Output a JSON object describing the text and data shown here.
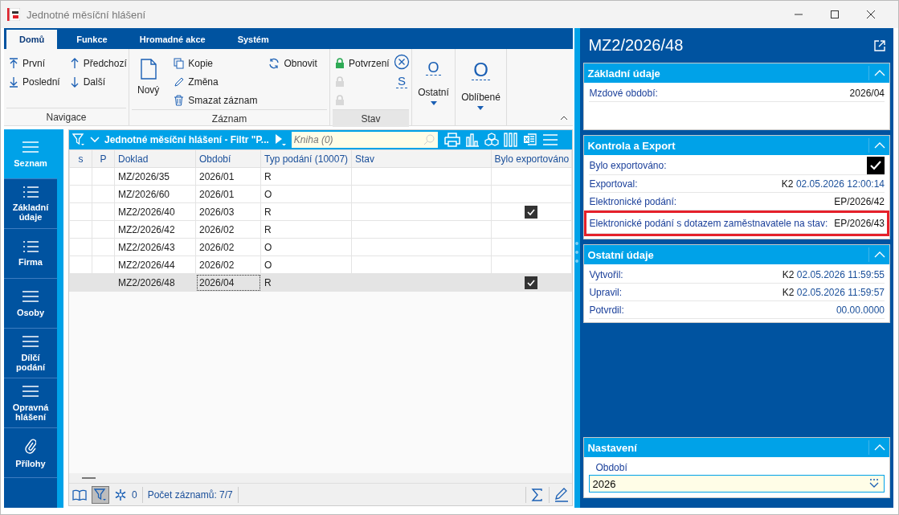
{
  "window": {
    "title": "Jednotné měsíční hlášení"
  },
  "ribbon": {
    "tabs": [
      {
        "label": "Domů",
        "selected": true
      },
      {
        "label": "Funkce",
        "selected": false
      },
      {
        "label": "Hromadné akce",
        "selected": false
      },
      {
        "label": "Systém",
        "selected": false
      }
    ],
    "navigace": {
      "title": "Navigace",
      "buttons": [
        {
          "label": "První",
          "kind": "first"
        },
        {
          "label": "Předchozí",
          "kind": "up"
        },
        {
          "label": "Poslední",
          "kind": "last"
        },
        {
          "label": "Další",
          "kind": "down"
        }
      ]
    },
    "zaznam": {
      "title": "Záznam",
      "new": "Nový",
      "buttons": [
        {
          "label": "Kopie",
          "kind": "copy"
        },
        {
          "label": "Změna",
          "kind": "edit"
        },
        {
          "label": "Smazat záznam",
          "kind": "delete"
        }
      ],
      "refresh": "Obnovit"
    },
    "stav": {
      "title": "Stav",
      "locks": [
        {
          "label": "Potvrzení",
          "disabled": false
        },
        {
          "disabled": true
        },
        {
          "disabled": true
        }
      ],
      "shortcut": "S"
    },
    "menus": [
      {
        "label": "Ostatní",
        "glyph": "O"
      },
      {
        "label": "Oblíbené",
        "glyph": "O"
      }
    ]
  },
  "sidebar": {
    "items": [
      {
        "label": "Seznam",
        "kind": "menu",
        "selected": true
      },
      {
        "label": "Základní údaje",
        "kind": "list",
        "selected": false
      },
      {
        "label": "Firma",
        "kind": "list",
        "selected": false
      },
      {
        "label": "Osoby",
        "kind": "menu",
        "selected": false
      },
      {
        "label": "Dílčí podání",
        "kind": "menu",
        "selected": false
      },
      {
        "label": "Opravná hlášení",
        "kind": "menu",
        "selected": false
      },
      {
        "label": "Přílohy",
        "kind": "attachment",
        "selected": false
      }
    ]
  },
  "grid": {
    "title": "Jednotné měsíční hlášení - Filtr \"P...",
    "search": {
      "placeholder": "Kniha (0)"
    },
    "columns": [
      "s",
      "P",
      "Doklad",
      "Období",
      "Typ podání (10007)",
      "Stav",
      "Bylo exportováno"
    ],
    "rows": [
      {
        "doklad": "MZ/2026/35",
        "obdobi": "2026/01",
        "typ": "R",
        "exported": false,
        "selected": false
      },
      {
        "doklad": "MZ/2026/60",
        "obdobi": "2026/01",
        "typ": "O",
        "exported": false,
        "selected": false
      },
      {
        "doklad": "MZ2/2026/40",
        "obdobi": "2026/03",
        "typ": "R",
        "exported": true,
        "selected": false
      },
      {
        "doklad": "MZ2/2026/42",
        "obdobi": "2026/02",
        "typ": "R",
        "exported": false,
        "selected": false
      },
      {
        "doklad": "MZ2/2026/43",
        "obdobi": "2026/02",
        "typ": "O",
        "exported": false,
        "selected": false
      },
      {
        "doklad": "MZ2/2026/44",
        "obdobi": "2026/02",
        "typ": "O",
        "exported": false,
        "selected": false
      },
      {
        "doklad": "MZ2/2026/48",
        "obdobi": "2026/04",
        "typ": "R",
        "exported": true,
        "selected": true
      }
    ],
    "footer": {
      "filter_on": true,
      "marked": "0",
      "count": "Počet záznamů: 7/7"
    }
  },
  "detail": {
    "title": "MZ2/2026/48",
    "sections": [
      {
        "title": "Základní údaje",
        "rows": [
          {
            "label": "Mzdové období:",
            "kind": "text",
            "value": "2026/04",
            "highlighted": false
          }
        ]
      },
      {
        "title": "Kontrola a Export",
        "rows": [
          {
            "label": "Bylo exportováno:",
            "kind": "check",
            "checked": true,
            "highlighted": false
          },
          {
            "label": "Exportoval:",
            "kind": "stamp",
            "user": "K2",
            "value": "02.05.2026 12:00:14",
            "highlighted": false
          },
          {
            "label": "Elektronické podání:",
            "kind": "text",
            "value": "EP/2026/42",
            "highlighted": false
          },
          {
            "label": "Elektronické podání s dotazem zaměstnavatele na stav:",
            "kind": "text",
            "value": "EP/2026/43",
            "highlighted": true
          }
        ]
      },
      {
        "title": "Ostatní údaje",
        "rows": [
          {
            "label": "Vytvořil:",
            "kind": "stamp",
            "user": "K2",
            "value": "02.05.2026 11:59:55",
            "highlighted": false
          },
          {
            "label": "Upravil:",
            "kind": "stamp",
            "user": "K2",
            "value": "02.05.2026 11:59:57",
            "highlighted": false
          },
          {
            "label": "Potvrdil:",
            "kind": "date",
            "value": "00.00.0000",
            "highlighted": false
          }
        ]
      }
    ],
    "settings": {
      "title": "Nastavení",
      "field": {
        "label": "Období",
        "value": "2026"
      }
    }
  }
}
